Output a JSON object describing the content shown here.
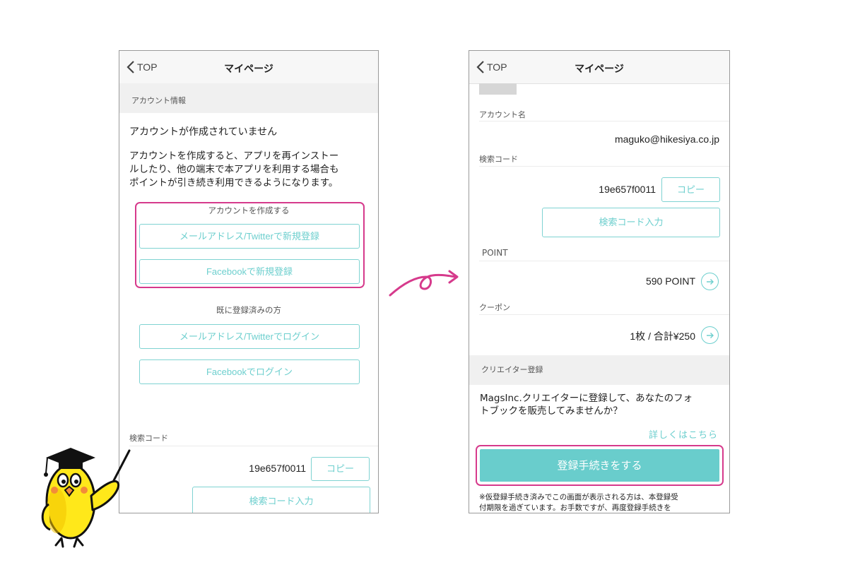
{
  "colors": {
    "accent": "#6dcfce",
    "highlight": "#d63a8c",
    "primary_button": "#69cdcc"
  },
  "left": {
    "back_label": "TOP",
    "title": "マイページ",
    "section_account": "アカウント情報",
    "not_created": "アカウントが作成されていません",
    "description_lines": [
      "アカウントを作成すると、アプリを再インストー",
      "ルしたり、他の端末で本アプリを利用する場合も",
      "ポイントが引き続き利用できるようになります。"
    ],
    "create_label": "アカウントを作成する",
    "register_email_twitter": "メールアドレス/Twitterで新規登録",
    "register_facebook": "Facebookで新規登録",
    "already_registered": "既に登録済みの方",
    "login_email_twitter": "メールアドレス/Twitterでログイン",
    "login_facebook": "Facebookでログイン",
    "search_code_label": "検索コード",
    "search_code_value": "19e657f0011",
    "copy_button": "コピー",
    "search_code_input_button": "検索コード入力"
  },
  "right": {
    "back_label": "TOP",
    "title": "マイページ",
    "account_name_label": "アカウント名",
    "account_name_value": "maguko@hikesiya.co.jp",
    "search_code_label": "検索コード",
    "search_code_value": "19e657f0011",
    "copy_button": "コピー",
    "search_code_input_button": "検索コード入力",
    "point_label": "POINT",
    "point_value": "590 POINT",
    "coupon_label": "クーポン",
    "coupon_value": "1枚 / 合計¥250",
    "creator_section": "クリエイター登録",
    "creator_text_lines": [
      "MagsInc.クリエイターに登録して、あなたのフォ",
      "トブックを販売してみませんか？"
    ],
    "details_link": "詳しくはこちら",
    "register_button": "登録手続きをする",
    "notice_lines": [
      "※仮登録手続き済みでこの画面が表示される方は、本登録受",
      "付期限を過ぎています。お手数ですが、再度登録手続きを"
    ]
  }
}
